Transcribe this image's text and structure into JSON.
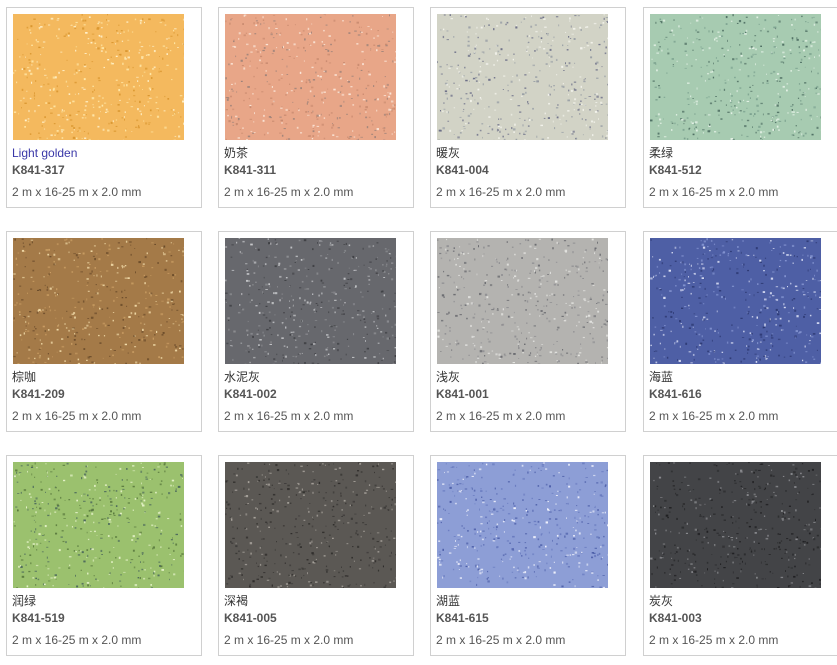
{
  "products": [
    {
      "name": "Light golden",
      "code": "K841-317",
      "size": "2 m x 16-25 m x 2.0 mm",
      "base": "#f4b95e",
      "flecks": [
        "#fff3cf",
        "#ffe7a6",
        "#d9962f"
      ],
      "name_color": "#3a37a8"
    },
    {
      "name": "奶茶",
      "code": "K841-311",
      "size": "2 m x 16-25 m x 2.0 mm",
      "base": "#e8a688",
      "flecks": [
        "#fbe6d8",
        "#9c8279",
        "#c98b70"
      ],
      "name_color": "#333333"
    },
    {
      "name": "暖灰",
      "code": "K841-004",
      "size": "2 m x 16-25 m x 2.0 mm",
      "base": "#d2d3c6",
      "flecks": [
        "#6b6e87",
        "#f3f3ec",
        "#9aa0a6"
      ],
      "name_color": "#333333"
    },
    {
      "name": "柔绿",
      "code": "K841-512",
      "size": "2 m x 16-25 m x 2.0 mm",
      "base": "#a7cbb1",
      "flecks": [
        "#4f6f63",
        "#e4f1e6",
        "#7aa08e"
      ],
      "name_color": "#333333"
    },
    {
      "name": "棕咖",
      "code": "K841-209",
      "size": "2 m x 16-25 m x 2.0 mm",
      "base": "#a47a48",
      "flecks": [
        "#f2dcaa",
        "#6b4c2b",
        "#c99d63"
      ],
      "name_color": "#333333"
    },
    {
      "name": "水泥灰",
      "code": "K841-002",
      "size": "2 m x 16-25 m x 2.0 mm",
      "base": "#67686d",
      "flecks": [
        "#c8c9cc",
        "#3f4044",
        "#8c8d91"
      ],
      "name_color": "#333333"
    },
    {
      "name": "浅灰",
      "code": "K841-001",
      "size": "2 m x 16-25 m x 2.0 mm",
      "base": "#b4b3b0",
      "flecks": [
        "#6a6b70",
        "#e3e3e0",
        "#8f8f92"
      ],
      "name_color": "#333333"
    },
    {
      "name": "海蓝",
      "code": "K841-616",
      "size": "2 m x 16-25 m x 2.0 mm",
      "base": "#4e5fa5",
      "flecks": [
        "#d7dcf2",
        "#2e3a74",
        "#8292cf"
      ],
      "name_color": "#333333"
    },
    {
      "name": "润绿",
      "code": "K841-519",
      "size": "2 m x 16-25 m x 2.0 mm",
      "base": "#9bc16e",
      "flecks": [
        "#e5f2c9",
        "#5a7a3e",
        "#4d6a5c"
      ],
      "name_color": "#333333"
    },
    {
      "name": "深褐",
      "code": "K841-005",
      "size": "2 m x 16-25 m x 2.0 mm",
      "base": "#5b5854",
      "flecks": [
        "#2f2d2b",
        "#a8a39c",
        "#3d3b39"
      ],
      "name_color": "#333333"
    },
    {
      "name": "湖蓝",
      "code": "K841-615",
      "size": "2 m x 16-25 m x 2.0 mm",
      "base": "#8d9ed6",
      "flecks": [
        "#eef0fb",
        "#4c5ea8",
        "#6a7cc0"
      ],
      "name_color": "#333333"
    },
    {
      "name": "炭灰",
      "code": "K841-003",
      "size": "2 m x 16-25 m x 2.0 mm",
      "base": "#434447",
      "flecks": [
        "#1f1f21",
        "#8a8b8f",
        "#2d2e30"
      ],
      "name_color": "#333333"
    }
  ]
}
